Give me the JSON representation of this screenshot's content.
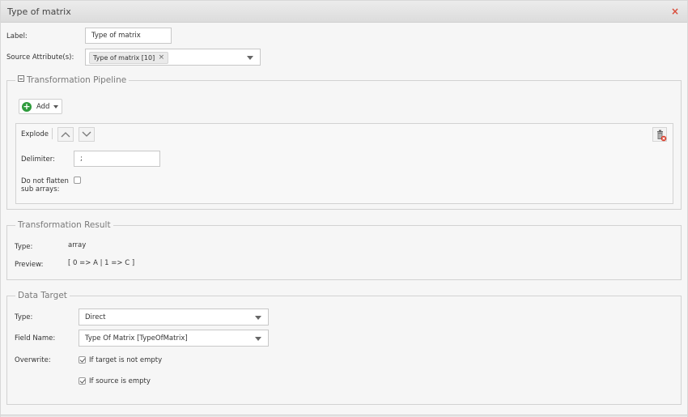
{
  "window": {
    "title": "Type of matrix",
    "close_icon": "×"
  },
  "form": {
    "label_label": "Label:",
    "label_value": "Type of matrix",
    "source_label": "Source Attribute(s):",
    "source_tag": "Type of matrix [10]",
    "source_tag_remove": "×"
  },
  "pipeline": {
    "legend": "Transformation Pipeline",
    "add_label": "Add",
    "step": {
      "name": "Explode",
      "delimiter_label": "Delimiter:",
      "delimiter_value": ";",
      "flatten_label_line1": "Do not flatten",
      "flatten_label_line2": "sub arrays:",
      "flatten_checked": false
    }
  },
  "result": {
    "legend": "Transformation Result",
    "type_label": "Type:",
    "type_value": "array",
    "preview_label": "Preview:",
    "preview_value": "[ 0 => A | 1 => C ]"
  },
  "target": {
    "legend": "Data Target",
    "type_label": "Type:",
    "type_value": "Direct",
    "field_label": "Field Name:",
    "field_value": "Type Of Matrix [TypeOfMatrix]",
    "overwrite_label": "Overwrite:",
    "opt1_label": "If target is not empty",
    "opt1_checked": true,
    "opt2_label": "If source is empty",
    "opt2_checked": true
  },
  "colors": {
    "add_icon": "#2e9b3c",
    "close_icon": "#d94c3a",
    "trash_badge": "#d9412f"
  }
}
